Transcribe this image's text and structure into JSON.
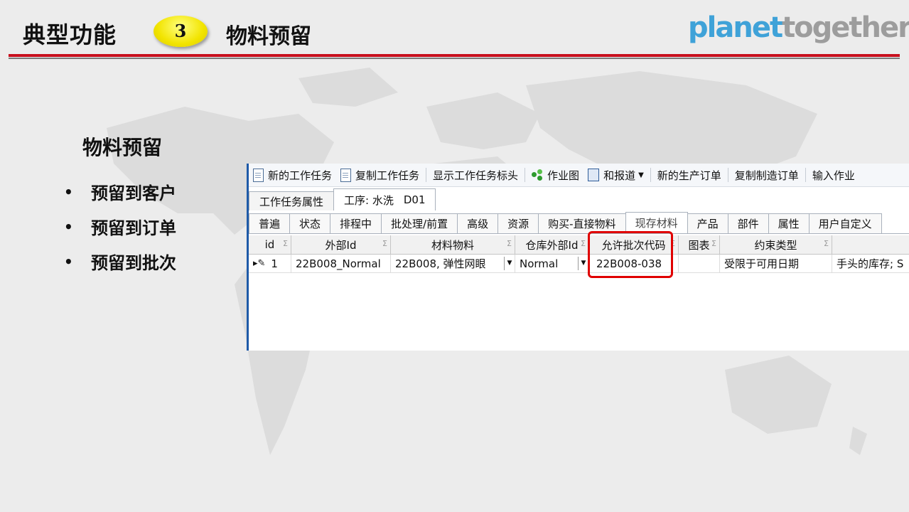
{
  "header": {
    "title": "典型功能",
    "step_number": "3",
    "subtitle": "物料预留",
    "logo_part1": "planet",
    "logo_part2": "together"
  },
  "left_panel": {
    "heading": "物料预留",
    "bullets": [
      "预留到客户",
      "预留到订单",
      "预留到批次"
    ]
  },
  "toolbar": {
    "new_task": "新的工作任务",
    "copy_task": "复制工作任务",
    "show_header": "显示工作任务标头",
    "gantt": "作业图",
    "report": "和报道",
    "new_order": "新的生产订单",
    "copy_order": "复制制造订单",
    "input": "输入作业"
  },
  "tabs_top": {
    "properties": "工作任务属性",
    "operation_label": "工序: 水洗",
    "operation_code": "D01"
  },
  "tabs_sub": [
    "普遍",
    "状态",
    "排程中",
    "批处理/前置",
    "高级",
    "资源",
    "购买-直接物料",
    "现存材料",
    "产品",
    "部件",
    "属性",
    "用户自定义"
  ],
  "grid": {
    "columns": [
      "id",
      "外部Id",
      "材料物料",
      "仓库外部Id",
      "允许批次代码",
      "图表",
      "约束类型",
      ""
    ],
    "row": {
      "id": "1",
      "external_id": "22B008_Normal",
      "material": "22B008, 弹性网眼",
      "warehouse": "Normal",
      "lot_code": "22B008-038",
      "chart": "",
      "constraint": "受限于可用日期",
      "extra": "手头的库存; S"
    },
    "sigma": "Σ"
  },
  "colors": {
    "accent_red": "#c8101e",
    "badge_yellow": "#f2e400",
    "logo_blue": "#3fa2d8",
    "logo_gray": "#9d9d9d"
  }
}
